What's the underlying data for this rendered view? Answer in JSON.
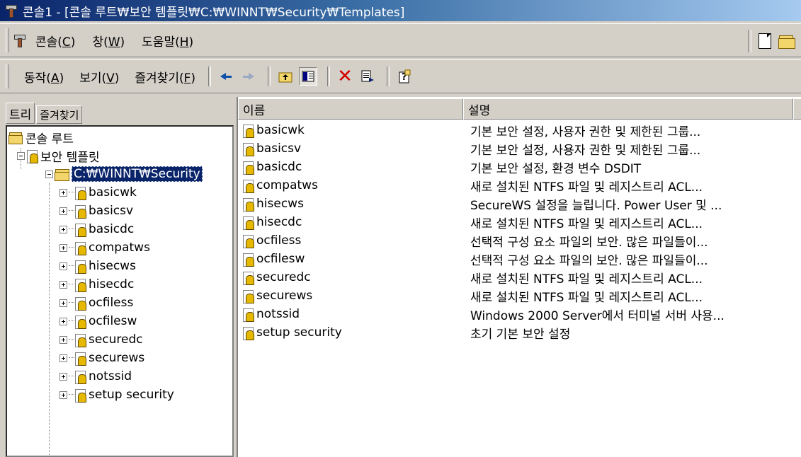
{
  "window": {
    "title": "콘솔1 - [콘솔 루트₩보안 템플릿₩C:₩WINNT₩Security₩Templates]"
  },
  "menubar": {
    "items": [
      {
        "label": "콘솔(",
        "key": "C",
        "end": ")"
      },
      {
        "label": "창(",
        "key": "W",
        "end": ")"
      },
      {
        "label": "도움말(",
        "key": "H",
        "end": ")"
      }
    ]
  },
  "actionbar": {
    "items": [
      {
        "label": "동작(",
        "key": "A",
        "end": ")"
      },
      {
        "label": "보기(",
        "key": "V",
        "end": ")"
      },
      {
        "label": "즐겨찾기(",
        "key": "F",
        "end": ")"
      }
    ],
    "tools": [
      "back-arrow-icon",
      "forward-arrow-icon",
      "up-folder-icon",
      "show-hide-tree-icon",
      "delete-icon",
      "export-list-icon",
      "help-icon"
    ]
  },
  "tabs": [
    "트리",
    "즐겨찾기"
  ],
  "tree": {
    "root": "콘솔 루트",
    "snapin": "보안 템플릿",
    "path": "C:₩WINNT₩Security",
    "children": [
      "basicwk",
      "basicsv",
      "basicdc",
      "compatws",
      "hisecws",
      "hisecdc",
      "ocfiless",
      "ocfilesw",
      "securedc",
      "securews",
      "notssid",
      "setup security"
    ]
  },
  "list": {
    "columns": [
      "이름",
      "설명"
    ],
    "rows": [
      {
        "name": "basicwk",
        "desc": "기본 보안 설정, 사용자 권한 및 제한된 그룹..."
      },
      {
        "name": "basicsv",
        "desc": "기본 보안 설정, 사용자 권한 및 제한된 그룹..."
      },
      {
        "name": "basicdc",
        "desc": "기본 보안 설정, 환경 변수 DSDIT"
      },
      {
        "name": "compatws",
        "desc": "새로 설치된 NTFS 파일 및 레지스트리 ACL..."
      },
      {
        "name": "hisecws",
        "desc": "SecureWS 설정을 늘립니다. Power User 및 ..."
      },
      {
        "name": "hisecdc",
        "desc": "새로 설치된 NTFS 파일 및 레지스트리 ACL..."
      },
      {
        "name": "ocfiless",
        "desc": "선택적 구성 요소 파일의 보안. 많은 파일들이..."
      },
      {
        "name": "ocfilesw",
        "desc": "선택적 구성 요소 파일의 보안. 많은 파일들이..."
      },
      {
        "name": "securedc",
        "desc": "새로 설치된 NTFS 파일 및 레지스트리 ACL..."
      },
      {
        "name": "securews",
        "desc": "새로 설치된 NTFS 파일 및 레지스트리 ACL..."
      },
      {
        "name": "notssid",
        "desc": "Windows 2000 Server에서 터미널 서버 사용..."
      },
      {
        "name": "setup security",
        "desc": "초기 기본 보안 설정"
      }
    ]
  },
  "colors": {
    "title_start": "#0a246a",
    "title_end": "#a6caf0",
    "selection": "#0a246a",
    "chrome": "#d4d0c8"
  }
}
